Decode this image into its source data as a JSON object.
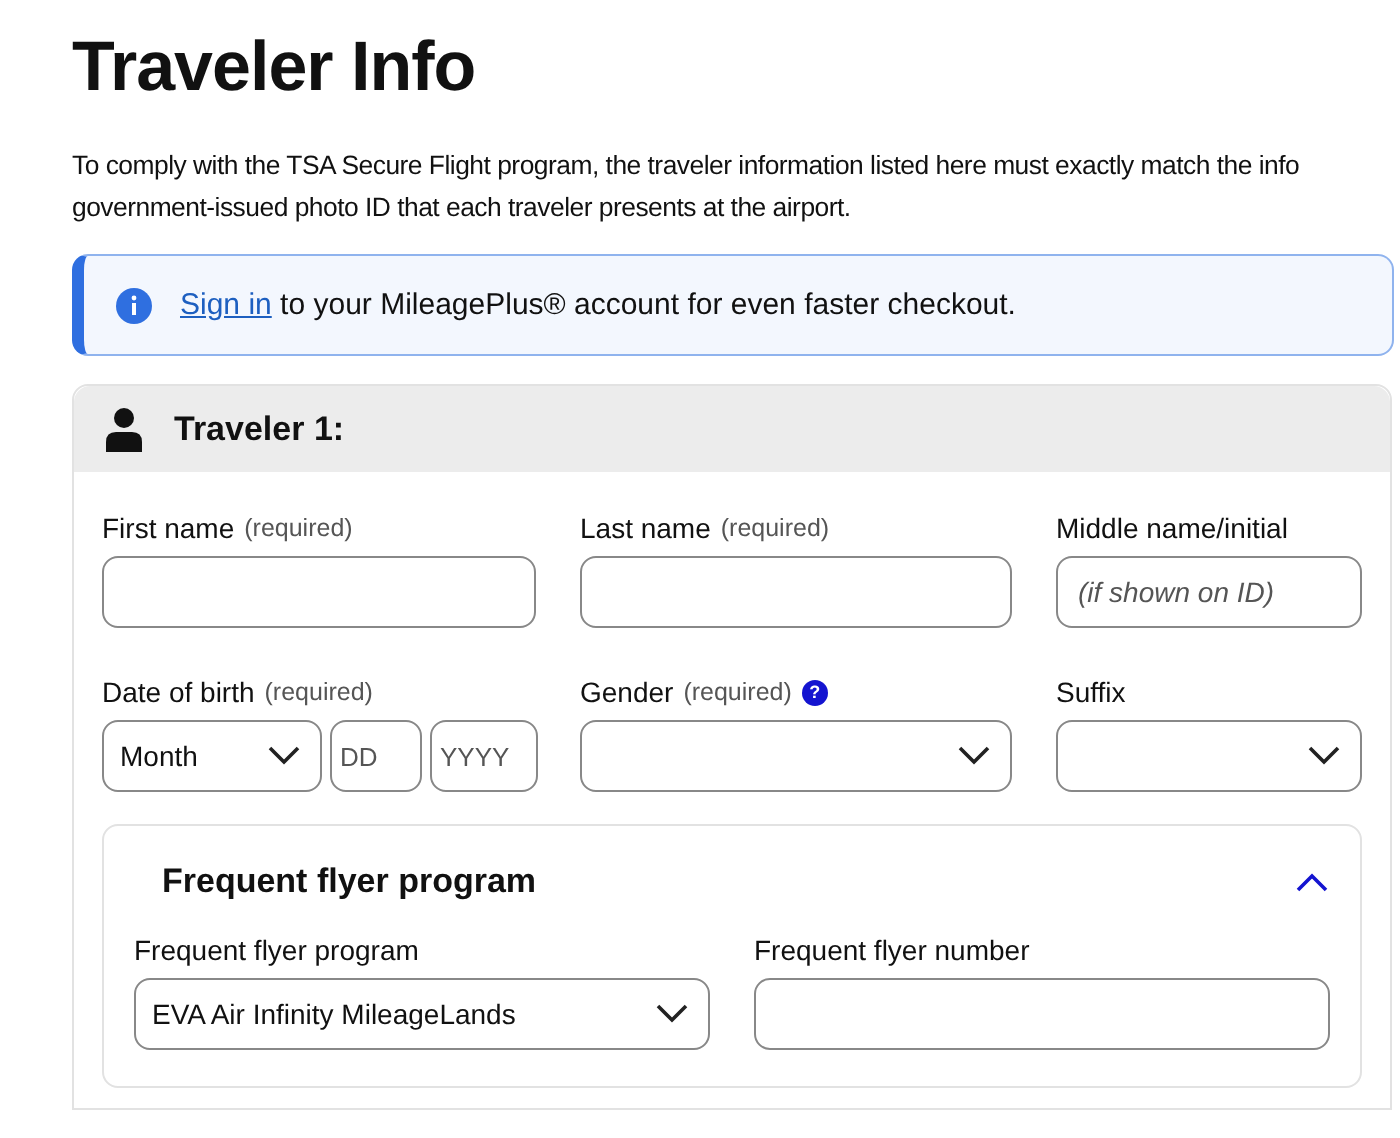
{
  "page_title": "Traveler Info",
  "intro_lines": [
    "To comply with the TSA Secure Flight program, the traveler information listed here must exactly match the info",
    "government-issued photo ID that each traveler presents at the airport."
  ],
  "notice": {
    "link": "Sign in",
    "text": "to your MileagePlus® account for even faster checkout."
  },
  "traveler": {
    "title": "Traveler 1:",
    "fields": [
      {
        "kind": "text",
        "label": "First name",
        "hint": "(required)"
      },
      {
        "kind": "text",
        "label": "Last name",
        "hint": "(required)"
      },
      {
        "kind": "text",
        "label": "Middle name/initial",
        "placeholder": "(if shown on ID)"
      },
      {
        "kind": "date",
        "label": "Date of birth",
        "hint": "(required)",
        "parts": [
          {
            "kind": "select",
            "placeholder": "Month"
          },
          {
            "kind": "text",
            "placeholder": "DD"
          },
          {
            "kind": "text",
            "placeholder": "YYYY"
          }
        ]
      },
      {
        "kind": "select",
        "label": "Gender",
        "hint": "(required)",
        "help": "?"
      },
      {
        "kind": "select",
        "label": "Suffix"
      }
    ],
    "frequent_flyer": {
      "title": "Frequent flyer program",
      "expanded": true,
      "fields": [
        {
          "kind": "select",
          "label": "Frequent flyer program",
          "value": "EVA Air Infinity MileageLands"
        },
        {
          "kind": "text",
          "label": "Frequent flyer number"
        }
      ]
    }
  }
}
